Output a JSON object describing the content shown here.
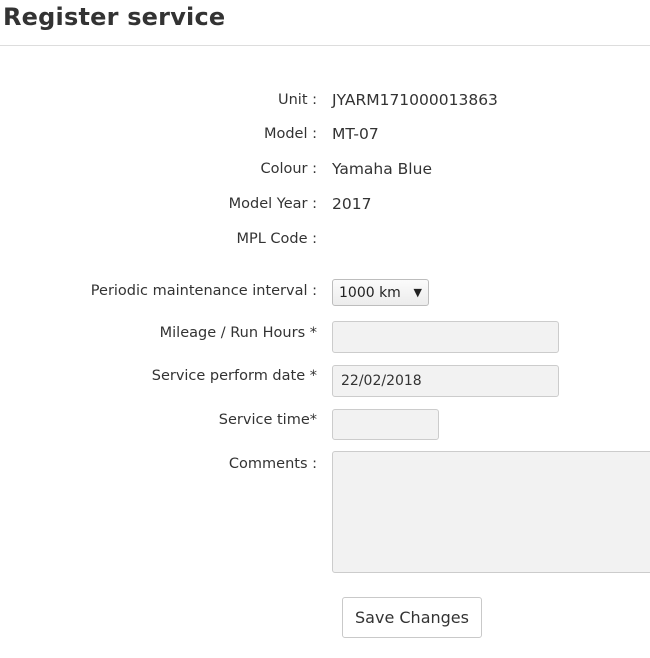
{
  "page": {
    "title": "Register service"
  },
  "details": {
    "unit_label": "Unit :",
    "unit_value": "JYARM171000013863",
    "model_label": "Model :",
    "model_value": "MT-07",
    "colour_label": "Colour :",
    "colour_value": "Yamaha Blue",
    "model_year_label": "Model Year :",
    "model_year_value": "2017",
    "mpl_code_label": "MPL Code :",
    "mpl_code_value": ""
  },
  "form": {
    "interval_label": "Periodic maintenance interval :",
    "interval_value": "1000 km",
    "mileage_label": "Mileage / Run Hours *",
    "mileage_value": "",
    "service_date_label": "Service perform date *",
    "service_date_value": "22/02/2018",
    "service_time_label": "Service time*",
    "service_time_value": "",
    "comments_label": "Comments :",
    "comments_value": "",
    "save_label": "Save Changes"
  },
  "icons": {
    "select_arrow": "triangle-down"
  }
}
